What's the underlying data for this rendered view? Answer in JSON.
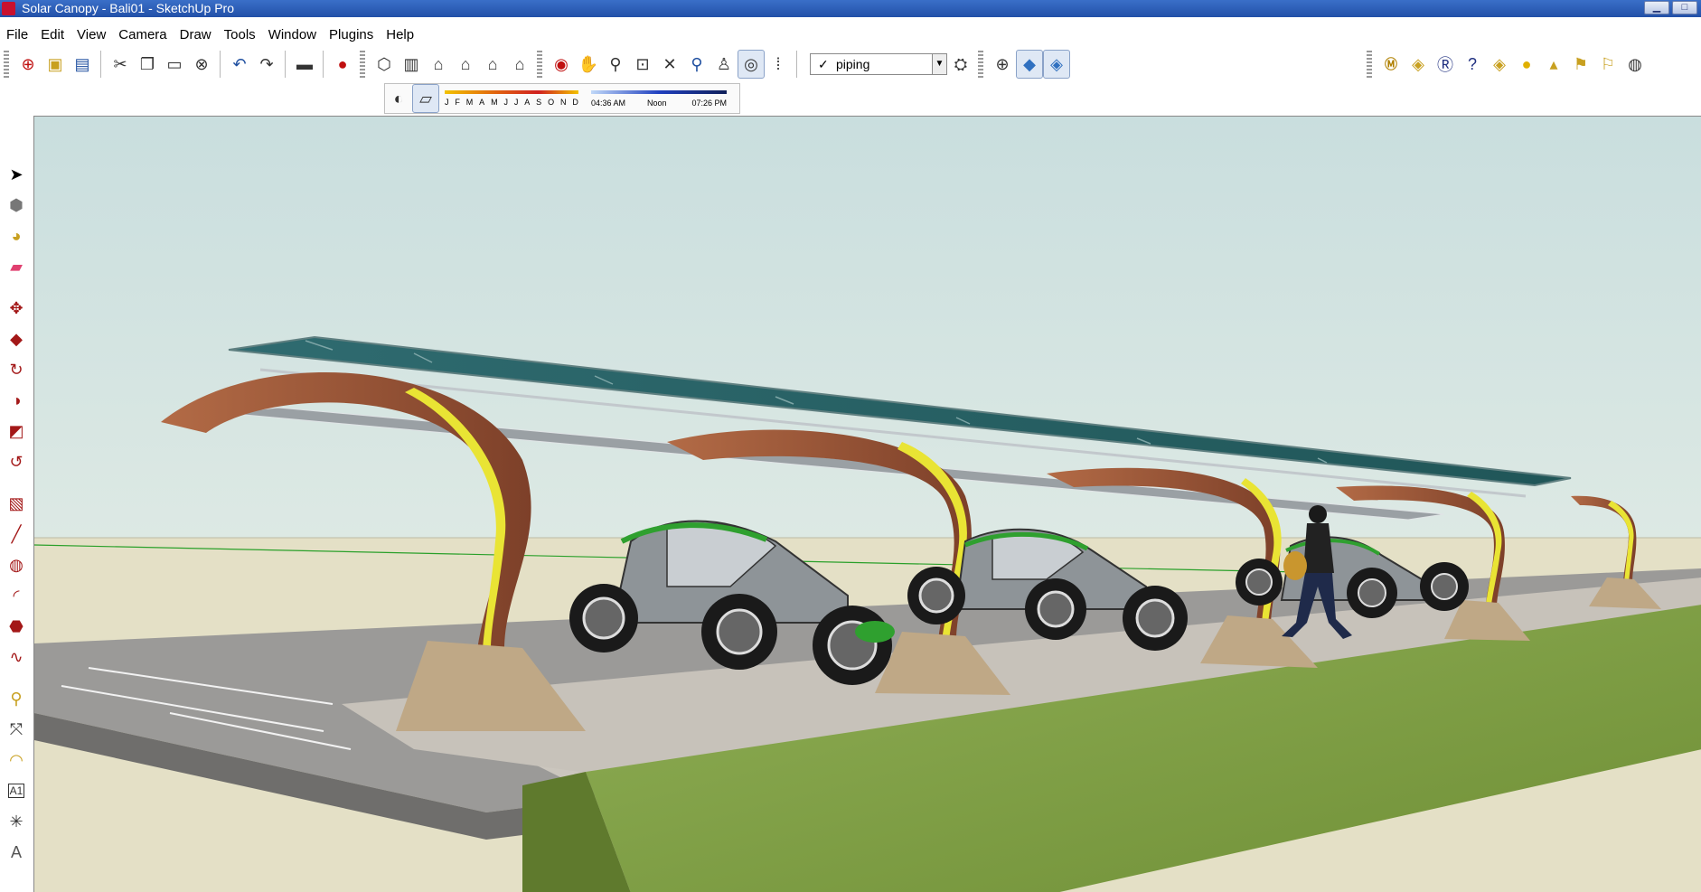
{
  "window": {
    "title": "Solar Canopy - Bali01 - SketchUp Pro",
    "minimize": "▁",
    "maximize": "□"
  },
  "menu": [
    "File",
    "Edit",
    "View",
    "Camera",
    "Draw",
    "Tools",
    "Window",
    "Plugins",
    "Help"
  ],
  "layers": {
    "current": "piping",
    "check": "✓"
  },
  "shadows": {
    "months": [
      "J",
      "F",
      "M",
      "A",
      "M",
      "J",
      "J",
      "A",
      "S",
      "O",
      "N",
      "D"
    ],
    "sunrise": "04:36 AM",
    "noon": "Noon",
    "sunset": "07:26 PM"
  },
  "toolbar": {
    "icons_left": [
      "new-icon",
      "open-icon",
      "save-icon",
      "cut-icon",
      "copy-icon",
      "paste-icon",
      "erase-icon",
      "undo-icon",
      "redo-icon",
      "print-icon",
      "model-info-icon"
    ],
    "icons_views": [
      "iso-view-icon",
      "top-view-icon",
      "front-view-icon",
      "right-view-icon",
      "back-view-icon",
      "left-view-icon"
    ],
    "icons_camera": [
      "orbit-icon",
      "pan-icon",
      "zoom-icon",
      "zoom-window-icon",
      "zoom-extents-icon",
      "previous-view-icon",
      "position-camera-icon",
      "look-around-icon",
      "walk-icon"
    ],
    "icons_right": [
      "plugin-m-icon",
      "tag-icon",
      "plugin-r-icon",
      "help-icon",
      "tag2-icon",
      "sphere-icon",
      "hat-icon",
      "flag-icon",
      "flag2-icon",
      "settings-icon"
    ]
  },
  "colors": {
    "title_bar": "#2a5cb8",
    "sky": "#cfe1e0",
    "ground": "#e3dfc5",
    "panel": "#2e6a6e",
    "arch": "#9a5a3c",
    "arch_stripe": "#e8e030",
    "grass": "#7fa042",
    "pavement": "#c9c4bd"
  }
}
